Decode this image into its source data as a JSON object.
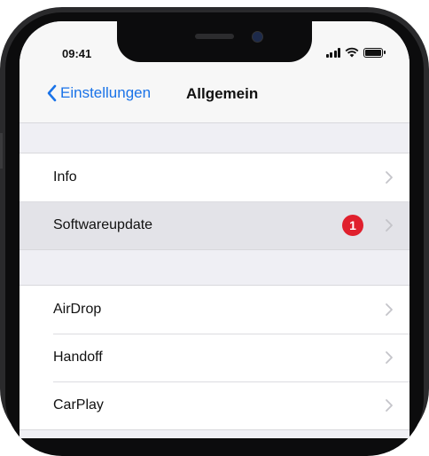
{
  "status_bar": {
    "time": "09:41"
  },
  "nav": {
    "back_label": "Einstellungen",
    "title": "Allgemein"
  },
  "groups": [
    {
      "items": [
        {
          "label": "Info"
        },
        {
          "label": "Softwareupdate",
          "badge": "1",
          "highlighted": true
        }
      ]
    },
    {
      "items": [
        {
          "label": "AirDrop"
        },
        {
          "label": "Handoff"
        },
        {
          "label": "CarPlay"
        }
      ]
    }
  ],
  "colors": {
    "accent": "#1a73e8",
    "badge": "#e0202d",
    "background": "#efeff4"
  }
}
